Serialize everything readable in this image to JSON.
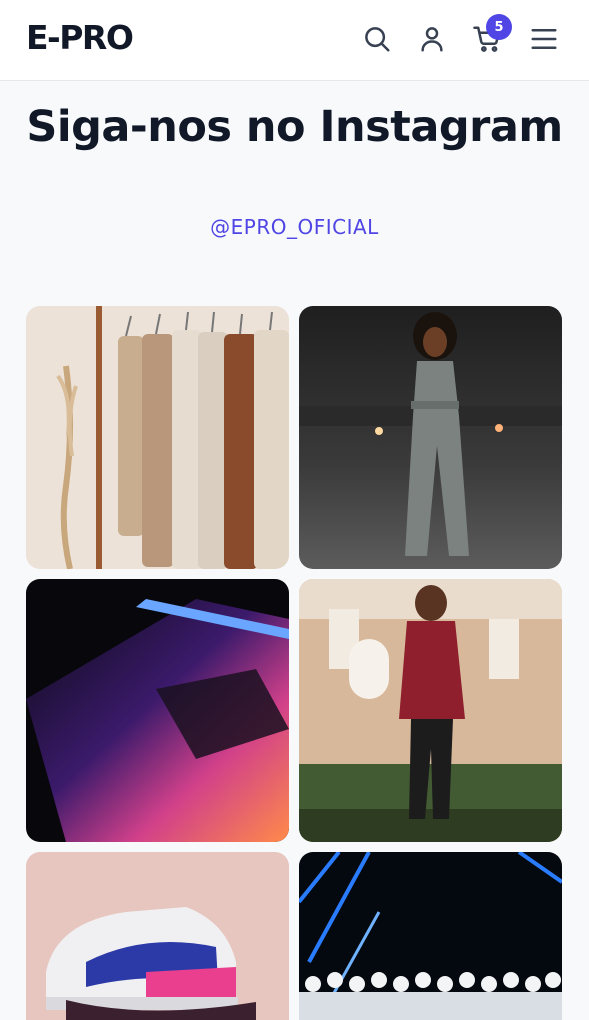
{
  "header": {
    "logo": "E-PRO",
    "cart_count": "5",
    "icons": [
      "search-icon",
      "user-icon",
      "cart-icon",
      "menu-icon"
    ]
  },
  "section": {
    "title": "Siga-nos no Instagram",
    "handle": "@EPRO_OFICIAL"
  },
  "gallery": {
    "photos": [
      "clothing-rack-photo",
      "woman-jumpsuit-photo",
      "laptop-photo",
      "woman-red-jacket-photo",
      "sneaker-photo",
      "stormtroopers-photo"
    ]
  },
  "colors": {
    "accent": "#4f46e5",
    "text": "#111827",
    "background": "#f8f9fb"
  }
}
